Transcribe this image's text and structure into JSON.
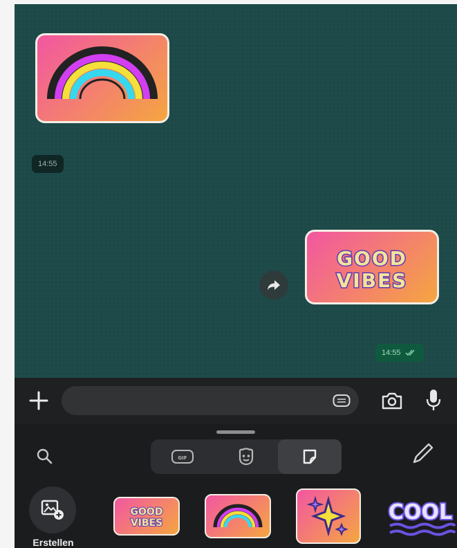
{
  "messages": [
    {
      "direction": "incoming",
      "sticker": "rainbow-sticker",
      "time": "14:55"
    },
    {
      "direction": "outgoing",
      "sticker": "good-vibes-sticker",
      "sticker_text": [
        "GOOD",
        "VIBES"
      ],
      "time": "14:55",
      "status_icon": "double-check-icon"
    }
  ],
  "composer": {
    "value": "",
    "placeholder": "",
    "icons": [
      "plus-icon",
      "keyboard-icon",
      "camera-icon",
      "microphone-icon"
    ]
  },
  "sticker_panel": {
    "tabs": [
      {
        "icon": "gif-icon",
        "label": "GIF",
        "active": false
      },
      {
        "icon": "avatar-icon",
        "active": false
      },
      {
        "icon": "sticker-icon",
        "active": true
      }
    ],
    "create_label": "Erstellen",
    "tray": [
      {
        "sticker": "good-vibes-sticker",
        "text": [
          "GOOD",
          "VIBES"
        ]
      },
      {
        "sticker": "rainbow-sticker"
      },
      {
        "sticker": "sparkle-sticker"
      },
      {
        "sticker": "cool-sticker",
        "text": "COOL"
      }
    ]
  },
  "colors": {
    "chat_background": "#1d4a48",
    "outgoing_time_background": "#0f5a3e",
    "sticker_gradient": [
      "#f256a2",
      "#f5a640"
    ],
    "panel_background": "#1b1c1e"
  }
}
